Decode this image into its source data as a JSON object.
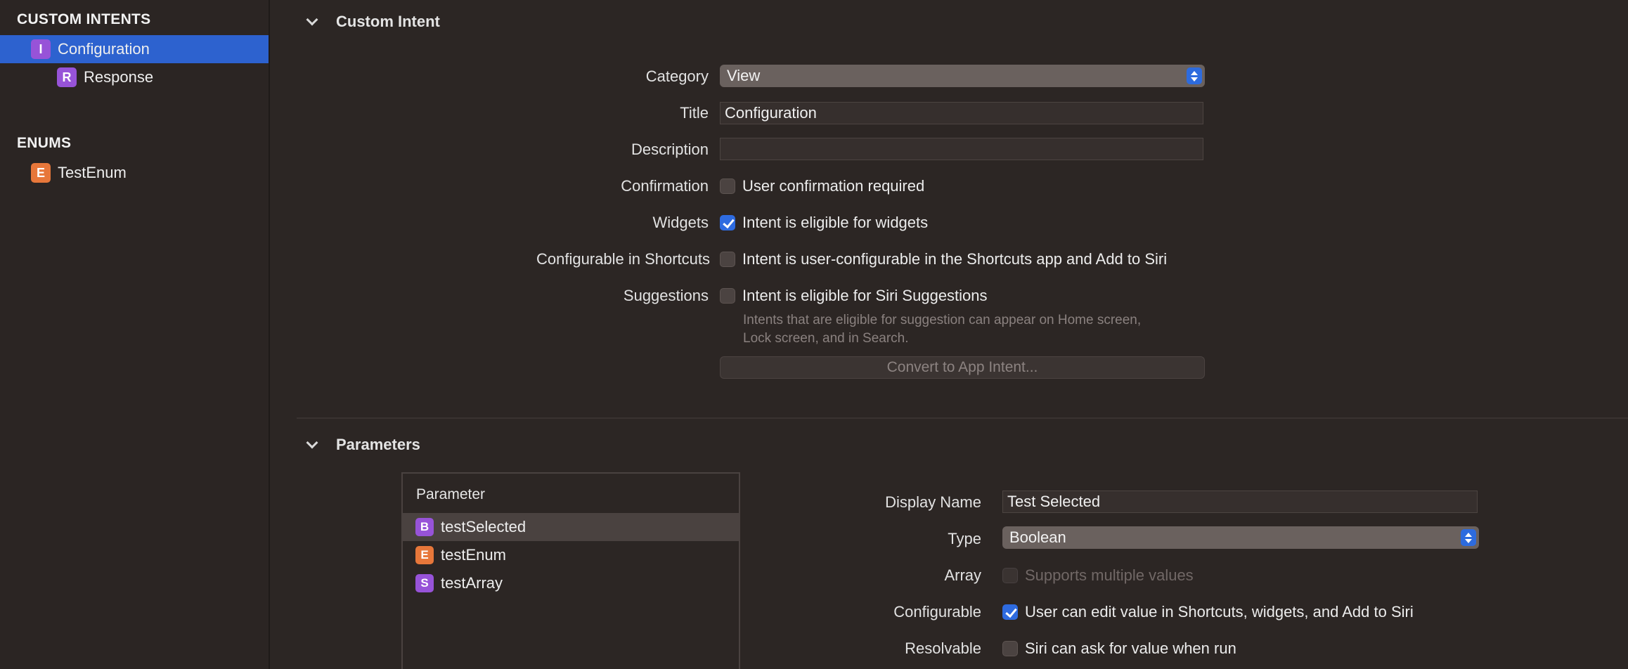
{
  "sidebar": {
    "custom_intents_header": "CUSTOM INTENTS",
    "intents": [
      {
        "badge": "I",
        "label": "Configuration",
        "selected": true
      },
      {
        "badge": "R",
        "label": "Response",
        "selected": false
      }
    ],
    "enums_header": "ENUMS",
    "enums": [
      {
        "badge": "E",
        "label": "TestEnum"
      }
    ]
  },
  "custom_intent": {
    "section_title": "Custom Intent",
    "category_label": "Category",
    "category_value": "View",
    "title_label": "Title",
    "title_value": "Configuration",
    "description_label": "Description",
    "description_value": "",
    "confirmation_label": "Confirmation",
    "confirmation_text": "User confirmation required",
    "confirmation_checked": false,
    "widgets_label": "Widgets",
    "widgets_text": "Intent is eligible for widgets",
    "widgets_checked": true,
    "configurable_label": "Configurable in Shortcuts",
    "configurable_text": "Intent is user-configurable in the Shortcuts app and Add to Siri",
    "configurable_checked": false,
    "suggestions_label": "Suggestions",
    "suggestions_text": "Intent is eligible for Siri Suggestions",
    "suggestions_checked": false,
    "suggestions_hint_line1": "Intents that are eligible for suggestion can appear on Home screen,",
    "suggestions_hint_line2": "Lock screen, and in Search.",
    "convert_button": "Convert to App Intent..."
  },
  "parameters": {
    "section_title": "Parameters",
    "table_header": "Parameter",
    "rows": [
      {
        "badge": "B",
        "label": "testSelected",
        "selected": true
      },
      {
        "badge": "E",
        "label": "testEnum",
        "selected": false
      },
      {
        "badge": "S",
        "label": "testArray",
        "selected": false
      }
    ],
    "display_name_label": "Display Name",
    "display_name_value": "Test Selected",
    "type_label": "Type",
    "type_value": "Boolean",
    "array_label": "Array",
    "array_text": "Supports multiple values",
    "array_checked": false,
    "configurable_label": "Configurable",
    "configurable_text": "User can edit value in Shortcuts, widgets, and Add to Siri",
    "configurable_checked": true,
    "resolvable_label": "Resolvable",
    "resolvable_text": "Siri can ask for value when run",
    "resolvable_checked": false
  },
  "colors": {
    "background": "#2c2624",
    "selection": "#2d62cf",
    "badge_purple": "#9753d8",
    "badge_orange": "#e7773a",
    "checkbox_checked": "#2e6be0"
  },
  "icons": {
    "disclosure": "chevron-down-icon",
    "popup": "up-down-arrows-icon",
    "checkmark": "checkmark-icon"
  }
}
